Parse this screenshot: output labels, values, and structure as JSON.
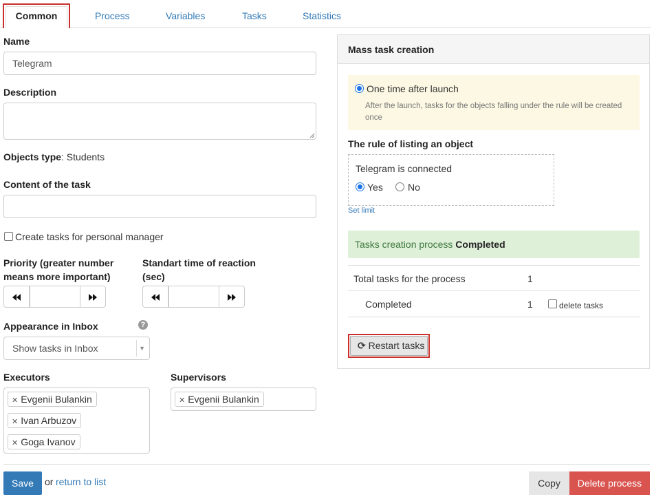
{
  "tabs": [
    "Common",
    "Process",
    "Variables",
    "Tasks",
    "Statistics"
  ],
  "name": {
    "label": "Name",
    "value": "Telegram"
  },
  "description": {
    "label": "Description",
    "value": ""
  },
  "objects_type": {
    "label": "Objects type",
    "value": ": Students"
  },
  "content": {
    "label": "Content of the task",
    "value": ""
  },
  "personal_manager": {
    "label": "Create tasks for personal manager",
    "checked": false
  },
  "priority": {
    "label_line1": "Priority (greater number",
    "label_line2": "means more important)",
    "value": ""
  },
  "reaction": {
    "label_line1": "Standart time of reaction",
    "label_line2": "(sec)",
    "value": ""
  },
  "inbox": {
    "label": "Appearance in Inbox",
    "value": "Show tasks in Inbox"
  },
  "executors": {
    "label": "Executors",
    "items": [
      "Evgenii Bulankin",
      "Ivan Arbuzov",
      "Goga Ivanov"
    ]
  },
  "supervisors": {
    "label": "Supervisors",
    "items": [
      "Evgenii Bulankin"
    ]
  },
  "mass": {
    "title": "Mass task creation",
    "option_label": "One time after launch",
    "option_desc_1": "After the launch, tasks for the objects falling under the rule will be created",
    "option_desc_2": "once",
    "rule_title": "The rule of listing an object",
    "rule_condition": "Telegram is connected",
    "yes": "Yes",
    "no": "No",
    "selected": "Yes",
    "set_limit": "Set limit",
    "status_prefix": "Tasks creation process ",
    "status_value": "Completed",
    "total_label": "Total tasks for the process",
    "total_value": "1",
    "completed_label": "Completed",
    "completed_value": "1",
    "delete_tasks": "delete tasks",
    "restart": "Restart tasks"
  },
  "footer": {
    "save": "Save",
    "or": "or",
    "return": "return to list",
    "copy": "Copy",
    "delete": "Delete process"
  },
  "colors": {
    "link": "#337ab7",
    "save": "#337ab7",
    "delete": "#d9534f",
    "highlight": "#c9302c",
    "status_bg": "#dff0d8",
    "note_bg": "#fcf8e3"
  }
}
